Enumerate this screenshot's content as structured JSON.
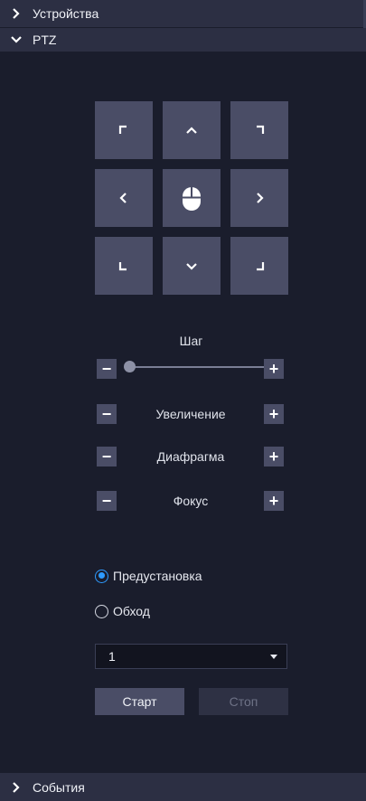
{
  "sections": {
    "devices": {
      "label": "Устройства",
      "expanded": false
    },
    "ptz": {
      "label": "PTZ",
      "expanded": true
    },
    "events": {
      "label": "События",
      "expanded": false
    }
  },
  "ptz": {
    "directions": [
      {
        "name": "up-left",
        "icon": "corner-up-left-icon"
      },
      {
        "name": "up",
        "icon": "chevron-up-icon"
      },
      {
        "name": "up-right",
        "icon": "corner-up-right-icon"
      },
      {
        "name": "left",
        "icon": "chevron-left-icon"
      },
      {
        "name": "center",
        "icon": "mouse-icon"
      },
      {
        "name": "right",
        "icon": "chevron-right-icon"
      },
      {
        "name": "down-left",
        "icon": "corner-down-left-icon"
      },
      {
        "name": "down",
        "icon": "chevron-down-icon"
      },
      {
        "name": "down-right",
        "icon": "corner-down-right-icon"
      }
    ],
    "step": {
      "label": "Шаг",
      "value_fraction": 0.0,
      "minus": "−",
      "plus": "+"
    },
    "zoom": {
      "label": "Увеличение",
      "minus": "−",
      "plus": "+"
    },
    "iris": {
      "label": "Диафрагма",
      "minus": "−",
      "plus": "+"
    },
    "focus": {
      "label": "Фокус",
      "minus": "−",
      "plus": "+"
    },
    "mode": {
      "options": [
        {
          "label": "Предустановка",
          "checked": true
        },
        {
          "label": "Обход",
          "checked": false
        }
      ]
    },
    "preset_select": {
      "value": "1"
    },
    "start_label": "Старт",
    "stop_label": "Стоп"
  },
  "colors": {
    "accent": "#2e9bff",
    "button": "#4a4d66",
    "panel_bg": "#1a1d2c",
    "header_bg": "#2c2f43"
  }
}
